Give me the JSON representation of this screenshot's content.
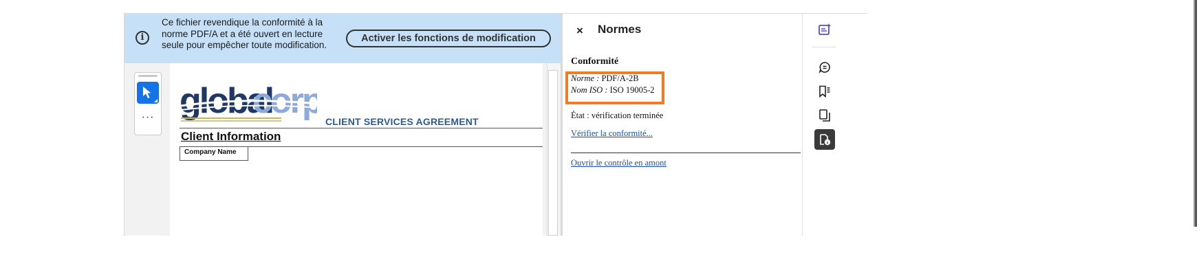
{
  "banner": {
    "message": "Ce fichier revendique la conformité à la norme PDF/A et a été ouvert en lecture seule pour empêcher toute modification.",
    "enable_button": "Activer les fonctions de modification",
    "info_icon": "i"
  },
  "toolbar": {
    "more_label": "···"
  },
  "document": {
    "logo_text": "globalcorp",
    "title": "CLIENT SERVICES AGREEMENT",
    "section_heading": "Client Information",
    "field_label": "Company Name"
  },
  "panel": {
    "close_label": "×",
    "title": "Normes",
    "conformity_heading": "Conformité",
    "standard_label": "Norme :",
    "standard_value": "PDF/A-2B",
    "iso_label": "Nom ISO :",
    "iso_value": "ISO 19005-2",
    "status": "État : vérification terminée",
    "verify_link": "Vérifier la conformité...",
    "preflight_link": "Ouvrir le contrôle en amont"
  },
  "rail": {
    "icons": [
      "edit-ai-icon",
      "comment-icon",
      "bookmarks-icon",
      "pages-icon",
      "standards-icon"
    ],
    "active_icon": "standards-icon"
  },
  "colors": {
    "banner_bg": "#c6e1f7",
    "accent_blue": "#1473e6",
    "highlight": "#f07c24",
    "link": "#1a4ea8",
    "logo_dark": "#1f3864",
    "logo_light": "#8eaadb"
  }
}
